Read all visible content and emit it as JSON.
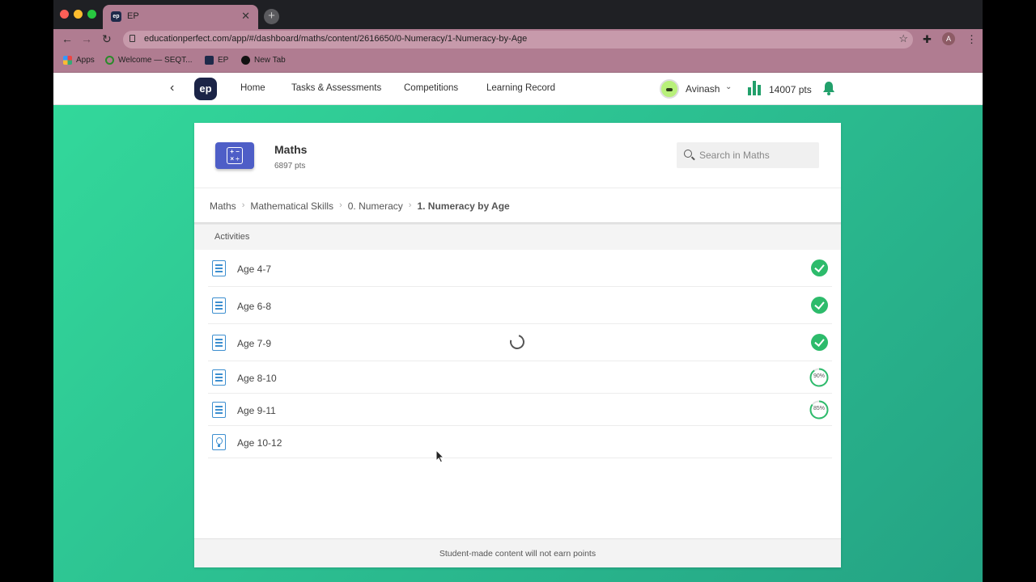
{
  "browser": {
    "tab_title": "EP",
    "tab_favicon": "ep",
    "url": "educationperfect.com/app/#/dashboard/maths/content/2616650/0-Numeracy/1-Numeracy-by-Age",
    "profile_initial": "A",
    "bookmarks": [
      {
        "label": "Apps",
        "icon": "apps-grid-icon",
        "color": "#e44"
      },
      {
        "label": "Welcome — SEQT...",
        "icon": "globe-icon",
        "color": "#2a8a2a"
      },
      {
        "label": "EP",
        "icon": "ep-icon",
        "color": "#1e2a4a"
      },
      {
        "label": "New Tab",
        "icon": "circle-icon",
        "color": "#111"
      }
    ]
  },
  "nav": {
    "logo": "ep",
    "links": [
      "Home",
      "Tasks & Assessments",
      "Competitions",
      "Learning Record"
    ],
    "username": "Avinash",
    "points": "14007 pts"
  },
  "subject": {
    "name": "Maths",
    "points": "6897 pts",
    "icon_text": "+ −\n× ÷",
    "search_placeholder": "Search in Maths"
  },
  "breadcrumb": [
    "Maths",
    "Mathematical Skills",
    "0. Numeracy",
    "1. Numeracy by Age"
  ],
  "activities": {
    "header": "Activities",
    "items": [
      {
        "label": "Age 4-7",
        "icon": "list",
        "status": "complete"
      },
      {
        "label": "Age 6-8",
        "icon": "list",
        "status": "complete"
      },
      {
        "label": "Age 7-9",
        "icon": "list",
        "status": "complete"
      },
      {
        "label": "Age 8-10",
        "icon": "list",
        "status": "progress",
        "progress": "90%",
        "progress_value": 0.9
      },
      {
        "label": "Age 9-11",
        "icon": "list",
        "status": "progress",
        "progress": "85%",
        "progress_value": 0.85
      },
      {
        "label": "Age 10-12",
        "icon": "bulb",
        "status": "none"
      }
    ]
  },
  "footer_text": "Student-made content will not earn points",
  "colors": {
    "accent_green": "#2dbb6b",
    "background_green": "#2ab98e",
    "chrome_pink": "#b07c91",
    "ep_navy": "#1b2447",
    "subject_blue": "#4e5ec7"
  }
}
